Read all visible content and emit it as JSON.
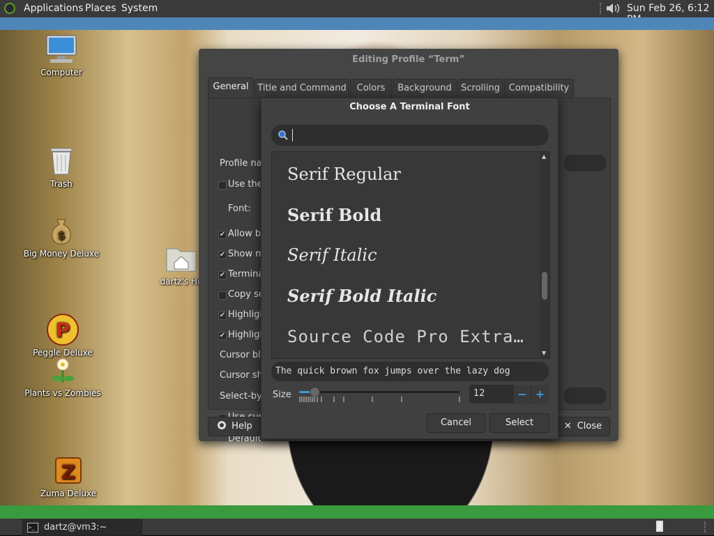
{
  "top_panel": {
    "menu": [
      "Applications",
      "Places",
      "System"
    ],
    "clock": "Sun Feb 26,  6:12 PM"
  },
  "desktop": {
    "icons": [
      {
        "label": "Computer",
        "icon": "computer-icon"
      },
      {
        "label": "Trash",
        "icon": "trash-icon"
      },
      {
        "label": "Big Money Deluxe",
        "icon": "money-bag-icon"
      },
      {
        "label": "dartz's Ho",
        "icon": "home-folder-icon"
      },
      {
        "label": "Peggle Deluxe",
        "icon": "peggle-icon"
      },
      {
        "label": "Plants vs Zombies",
        "icon": "plant-icon"
      },
      {
        "label": "Zuma Deluxe",
        "icon": "zuma-icon"
      }
    ]
  },
  "profile_dialog": {
    "title": "Editing Profile “Term”",
    "tabs": [
      "General",
      "Title and Command",
      "Colors",
      "Background",
      "Scrolling",
      "Compatibility"
    ],
    "active_tab": "General",
    "rows": {
      "profile_name": "Profile nar",
      "use_the": "Use the",
      "font": "Font:",
      "allow_bold": "Allow bo",
      "show_menu": "Show m",
      "terminal_bell": "Termina",
      "copy_selection": "Copy se",
      "highlight1": "Highligh",
      "highlight2": "Highligh",
      "cursor_blink": "Cursor blin",
      "cursor_shape": "Cursor sha",
      "select_by": "Select-by-",
      "use_custom": "Use cust",
      "default": "Default"
    },
    "help_label": "Help",
    "close_label": "Close"
  },
  "font_chooser": {
    "title": "Choose A Terminal Font",
    "search_value": "",
    "fonts": [
      "Serif Regular",
      "Serif Bold",
      "Serif Italic",
      "Serif Bold Italic",
      "Source Code Pro Extra…"
    ],
    "preview_text": "The quick brown fox jumps over the lazy dog",
    "size_label": "Size",
    "size_value": "12",
    "slider_fraction": 0.09,
    "minus_label": "−",
    "plus_label": "+",
    "cancel_label": "Cancel",
    "select_label": "Select"
  },
  "taskbar": {
    "window_label": "dartz@vm3:~"
  },
  "colors": {
    "top_strip": "#4f86b8",
    "bottom_strip": "#3a9a3e",
    "accent": "#3a9ad9"
  }
}
